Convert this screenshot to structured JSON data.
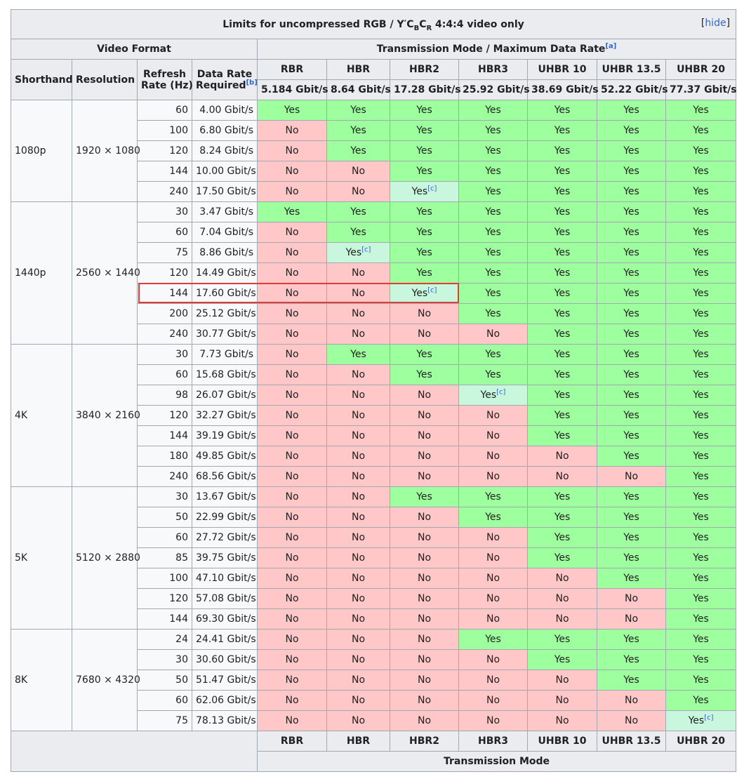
{
  "title": {
    "prefix": "Limits for uncompressed RGB / Y′C",
    "sub1": "B",
    "mid": "C",
    "sub2": "R",
    "suffix": " 4:4:4 video only"
  },
  "hide": {
    "open": "[",
    "link": "hide",
    "close": "]"
  },
  "headers": {
    "video_format": "Video Format",
    "transmission": "Transmission Mode / Maximum Data Rate",
    "transmission_note": "[a]",
    "shorthand": "Shorthand",
    "resolution": "Resolution",
    "refresh_1": "Refresh",
    "refresh_2": "Rate (Hz)",
    "datarate_1": "Data Rate",
    "datarate_2": "Required",
    "datarate_note": "[b]",
    "footer_mode": "Transmission Mode"
  },
  "modes": [
    "RBR",
    "HBR",
    "HBR2",
    "HBR3",
    "UHBR 10",
    "UHBR 13.5",
    "UHBR 20"
  ],
  "mode_rates": [
    "5.184 Gbit/s",
    "8.64 Gbit/s",
    "17.28 Gbit/s",
    "25.92 Gbit/s",
    "38.69 Gbit/s",
    "52.22 Gbit/s",
    "77.37 Gbit/s"
  ],
  "labels": {
    "yes": "Yes",
    "no": "No",
    "note_c": "[c]"
  },
  "colors": {
    "yes": "#9eff9e",
    "no": "#ffc7c7",
    "marginal": "#c9f7dd",
    "header": "#eaecf0",
    "highlight": "#e53935"
  },
  "groups": [
    {
      "shorthand": "1080p",
      "resolution": "1920 × 1080",
      "rows": [
        {
          "hz": "60",
          "rate": "4.00 Gbit/s",
          "cells": [
            "Y",
            "Y",
            "Y",
            "Y",
            "Y",
            "Y",
            "Y"
          ]
        },
        {
          "hz": "100",
          "rate": "6.80 Gbit/s",
          "cells": [
            "N",
            "Y",
            "Y",
            "Y",
            "Y",
            "Y",
            "Y"
          ]
        },
        {
          "hz": "120",
          "rate": "8.24 Gbit/s",
          "cells": [
            "N",
            "Y",
            "Y",
            "Y",
            "Y",
            "Y",
            "Y"
          ]
        },
        {
          "hz": "144",
          "rate": "10.00 Gbit/s",
          "cells": [
            "N",
            "N",
            "Y",
            "Y",
            "Y",
            "Y",
            "Y"
          ]
        },
        {
          "hz": "240",
          "rate": "17.50 Gbit/s",
          "cells": [
            "N",
            "N",
            "C",
            "Y",
            "Y",
            "Y",
            "Y"
          ]
        }
      ]
    },
    {
      "shorthand": "1440p",
      "resolution": "2560 × 1440",
      "rows": [
        {
          "hz": "30",
          "rate": "3.47 Gbit/s",
          "cells": [
            "Y",
            "Y",
            "Y",
            "Y",
            "Y",
            "Y",
            "Y"
          ]
        },
        {
          "hz": "60",
          "rate": "7.04 Gbit/s",
          "cells": [
            "N",
            "Y",
            "Y",
            "Y",
            "Y",
            "Y",
            "Y"
          ]
        },
        {
          "hz": "75",
          "rate": "8.86 Gbit/s",
          "cells": [
            "N",
            "C",
            "Y",
            "Y",
            "Y",
            "Y",
            "Y"
          ]
        },
        {
          "hz": "120",
          "rate": "14.49 Gbit/s",
          "cells": [
            "N",
            "N",
            "Y",
            "Y",
            "Y",
            "Y",
            "Y"
          ]
        },
        {
          "hz": "144",
          "rate": "17.60 Gbit/s",
          "cells": [
            "N",
            "N",
            "C",
            "Y",
            "Y",
            "Y",
            "Y"
          ]
        },
        {
          "hz": "200",
          "rate": "25.12 Gbit/s",
          "cells": [
            "N",
            "N",
            "N",
            "Y",
            "Y",
            "Y",
            "Y"
          ]
        },
        {
          "hz": "240",
          "rate": "30.77 Gbit/s",
          "cells": [
            "N",
            "N",
            "N",
            "N",
            "Y",
            "Y",
            "Y"
          ]
        }
      ]
    },
    {
      "shorthand": "4K",
      "resolution": "3840 × 2160",
      "rows": [
        {
          "hz": "30",
          "rate": "7.73 Gbit/s",
          "cells": [
            "N",
            "Y",
            "Y",
            "Y",
            "Y",
            "Y",
            "Y"
          ]
        },
        {
          "hz": "60",
          "rate": "15.68 Gbit/s",
          "cells": [
            "N",
            "N",
            "Y",
            "Y",
            "Y",
            "Y",
            "Y"
          ]
        },
        {
          "hz": "98",
          "rate": "26.07 Gbit/s",
          "cells": [
            "N",
            "N",
            "N",
            "C",
            "Y",
            "Y",
            "Y"
          ]
        },
        {
          "hz": "120",
          "rate": "32.27 Gbit/s",
          "cells": [
            "N",
            "N",
            "N",
            "N",
            "Y",
            "Y",
            "Y"
          ]
        },
        {
          "hz": "144",
          "rate": "39.19 Gbit/s",
          "cells": [
            "N",
            "N",
            "N",
            "N",
            "Y",
            "Y",
            "Y"
          ]
        },
        {
          "hz": "180",
          "rate": "49.85 Gbit/s",
          "cells": [
            "N",
            "N",
            "N",
            "N",
            "N",
            "Y",
            "Y"
          ]
        },
        {
          "hz": "240",
          "rate": "68.56 Gbit/s",
          "cells": [
            "N",
            "N",
            "N",
            "N",
            "N",
            "N",
            "Y"
          ]
        }
      ]
    },
    {
      "shorthand": "5K",
      "resolution": "5120 × 2880",
      "rows": [
        {
          "hz": "30",
          "rate": "13.67 Gbit/s",
          "cells": [
            "N",
            "N",
            "Y",
            "Y",
            "Y",
            "Y",
            "Y"
          ]
        },
        {
          "hz": "50",
          "rate": "22.99 Gbit/s",
          "cells": [
            "N",
            "N",
            "N",
            "Y",
            "Y",
            "Y",
            "Y"
          ]
        },
        {
          "hz": "60",
          "rate": "27.72 Gbit/s",
          "cells": [
            "N",
            "N",
            "N",
            "N",
            "Y",
            "Y",
            "Y"
          ]
        },
        {
          "hz": "85",
          "rate": "39.75 Gbit/s",
          "cells": [
            "N",
            "N",
            "N",
            "N",
            "Y",
            "Y",
            "Y"
          ]
        },
        {
          "hz": "100",
          "rate": "47.10 Gbit/s",
          "cells": [
            "N",
            "N",
            "N",
            "N",
            "N",
            "Y",
            "Y"
          ]
        },
        {
          "hz": "120",
          "rate": "57.08 Gbit/s",
          "cells": [
            "N",
            "N",
            "N",
            "N",
            "N",
            "N",
            "Y"
          ]
        },
        {
          "hz": "144",
          "rate": "69.30 Gbit/s",
          "cells": [
            "N",
            "N",
            "N",
            "N",
            "N",
            "N",
            "Y"
          ]
        }
      ]
    },
    {
      "shorthand": "8K",
      "resolution": "7680 × 4320",
      "rows": [
        {
          "hz": "24",
          "rate": "24.41 Gbit/s",
          "cells": [
            "N",
            "N",
            "N",
            "Y",
            "Y",
            "Y",
            "Y"
          ]
        },
        {
          "hz": "30",
          "rate": "30.60 Gbit/s",
          "cells": [
            "N",
            "N",
            "N",
            "N",
            "Y",
            "Y",
            "Y"
          ]
        },
        {
          "hz": "50",
          "rate": "51.47 Gbit/s",
          "cells": [
            "N",
            "N",
            "N",
            "N",
            "N",
            "Y",
            "Y"
          ]
        },
        {
          "hz": "60",
          "rate": "62.06 Gbit/s",
          "cells": [
            "N",
            "N",
            "N",
            "N",
            "N",
            "N",
            "Y"
          ]
        },
        {
          "hz": "75",
          "rate": "78.13 Gbit/s",
          "cells": [
            "N",
            "N",
            "N",
            "N",
            "N",
            "N",
            "C"
          ]
        }
      ]
    }
  ]
}
